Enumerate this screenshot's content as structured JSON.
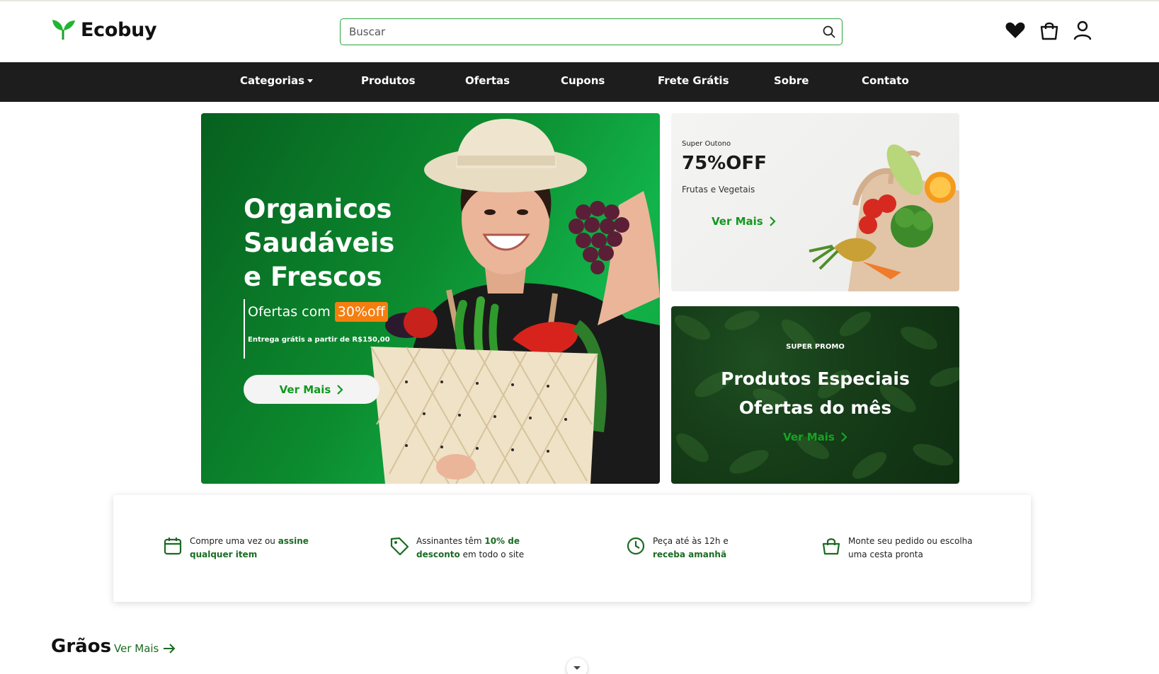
{
  "header": {
    "brand": "Ecobuy",
    "search": {
      "placeholder": "Buscar",
      "value": ""
    },
    "icons": [
      "heart-icon",
      "bag-icon",
      "user-icon"
    ]
  },
  "nav": {
    "items": [
      {
        "label": "Categorias",
        "has_dropdown": true
      },
      {
        "label": "Produtos"
      },
      {
        "label": "Ofertas"
      },
      {
        "label": "Cupons"
      },
      {
        "label": "Frete Grátis"
      },
      {
        "label": "Sobre"
      },
      {
        "label": "Contato"
      }
    ]
  },
  "hero": {
    "title_line1": "Organicos",
    "title_line2": "Saudáveis",
    "title_line3": "e Frescos",
    "offer_prefix": "Ofertas com",
    "offer_badge": "30%off",
    "subtitle": "Entrega grátis a partir de R$150,00",
    "button": "Ver Mais"
  },
  "promo_autumn": {
    "kicker": "Super Outono",
    "title": "75%OFF",
    "subtitle": "Frutas e Vegetais",
    "link": "Ver Mais"
  },
  "promo_special": {
    "kicker": "SUPER PROMO",
    "title_line1": "Produtos Especiais",
    "title_line2": "Ofertas do mês",
    "link": "Ver Mais"
  },
  "features": [
    {
      "icon": "calendar-icon",
      "pre": "Compre uma vez ou ",
      "bold": "assine qualquer item",
      "post": ""
    },
    {
      "icon": "tag-icon",
      "pre": "Assinantes têm ",
      "bold": "10% de desconto",
      "post": " em todo o site"
    },
    {
      "icon": "clock-icon",
      "pre": "Peça até às 12h e ",
      "bold": "receba amanhã",
      "post": ""
    },
    {
      "icon": "basket-icon",
      "pre": "Monte seu pedido ou escolha uma cesta pronta",
      "bold": "",
      "post": ""
    }
  ],
  "section": {
    "title": "Grãos",
    "link": "Ver Mais"
  },
  "colors": {
    "accent": "#12981f",
    "dark_green": "#1b6b23",
    "nav_bg": "#1d1d1d",
    "badge": "#f57e0f"
  }
}
